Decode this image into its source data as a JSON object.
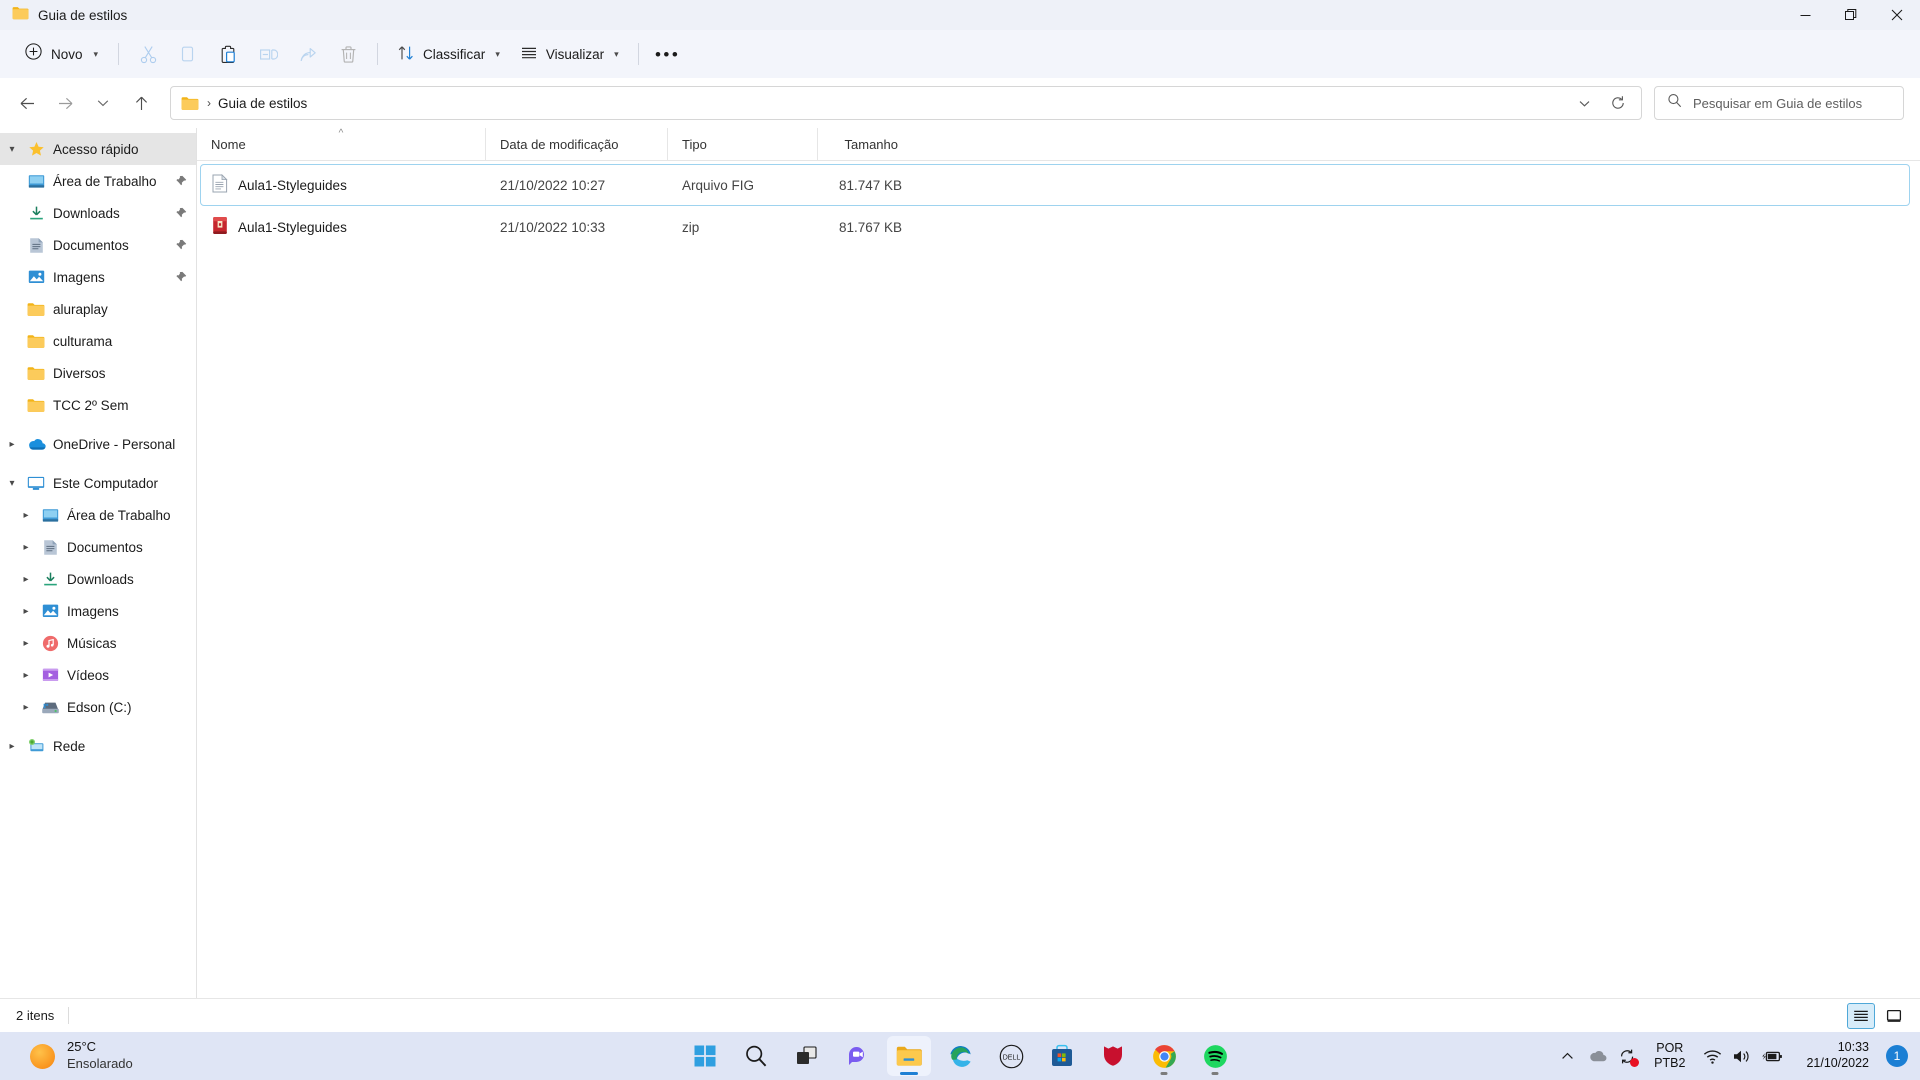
{
  "window": {
    "title": "Guia de estilos",
    "controls": {
      "minimize": "minimize-button",
      "maximize": "restore-button",
      "close": "close-button"
    }
  },
  "toolbar": {
    "new_label": "Novo",
    "sort_label": "Classificar",
    "view_label": "Visualizar",
    "more_label": "See more",
    "icons": [
      "cut-icon",
      "copy-icon",
      "paste-icon",
      "rename-icon",
      "share-icon",
      "delete-icon"
    ]
  },
  "addressbar": {
    "folder_name": "Guia de estilos",
    "separator": "›",
    "back": "back-button",
    "forward": "forward-button",
    "recent": "recent-locations-button",
    "up": "up-button",
    "previous_locations": "previous-locations-button",
    "refresh": "refresh-button"
  },
  "search": {
    "placeholder": "Pesquisar em Guia de estilos",
    "value": ""
  },
  "sidebar": {
    "items": [
      {
        "label": "Acesso rápido",
        "icon": "star-icon",
        "expander": "chevron-down",
        "level": 1,
        "selected": true,
        "pinned": false
      },
      {
        "label": "Área de Trabalho",
        "icon": "desktop-icon",
        "expander": "",
        "level": 2,
        "selected": false,
        "pinned": true
      },
      {
        "label": "Downloads",
        "icon": "downloads-icon",
        "expander": "",
        "level": 2,
        "selected": false,
        "pinned": true
      },
      {
        "label": "Documentos",
        "icon": "documents-icon",
        "expander": "",
        "level": 2,
        "selected": false,
        "pinned": true
      },
      {
        "label": "Imagens",
        "icon": "pictures-icon",
        "expander": "",
        "level": 2,
        "selected": false,
        "pinned": true
      },
      {
        "label": "aluraplay",
        "icon": "folder-icon",
        "expander": "",
        "level": 2,
        "selected": false,
        "pinned": false
      },
      {
        "label": "culturama",
        "icon": "folder-icon",
        "expander": "",
        "level": 2,
        "selected": false,
        "pinned": false
      },
      {
        "label": "Diversos",
        "icon": "folder-icon",
        "expander": "",
        "level": 2,
        "selected": false,
        "pinned": false
      },
      {
        "label": "TCC 2º Sem",
        "icon": "folder-icon",
        "expander": "",
        "level": 2,
        "selected": false,
        "pinned": false
      },
      {
        "label": "OneDrive - Personal",
        "icon": "onedrive-icon",
        "expander": "chevron-right",
        "level": 1,
        "selected": false,
        "pinned": false
      },
      {
        "label": "Este Computador",
        "icon": "this-pc-icon",
        "expander": "chevron-down",
        "level": 1,
        "selected": false,
        "pinned": false
      },
      {
        "label": "Área de Trabalho",
        "icon": "desktop-icon",
        "expander": "chevron-right",
        "level": 2,
        "selected": false,
        "pinned": false
      },
      {
        "label": "Documentos",
        "icon": "documents-icon",
        "expander": "chevron-right",
        "level": 2,
        "selected": false,
        "pinned": false
      },
      {
        "label": "Downloads",
        "icon": "downloads-icon",
        "expander": "chevron-right",
        "level": 2,
        "selected": false,
        "pinned": false
      },
      {
        "label": "Imagens",
        "icon": "pictures-icon",
        "expander": "chevron-right",
        "level": 2,
        "selected": false,
        "pinned": false
      },
      {
        "label": "Músicas",
        "icon": "music-icon",
        "expander": "chevron-right",
        "level": 2,
        "selected": false,
        "pinned": false
      },
      {
        "label": "Vídeos",
        "icon": "videos-icon",
        "expander": "chevron-right",
        "level": 2,
        "selected": false,
        "pinned": false
      },
      {
        "label": "Edson  (C:)",
        "icon": "local-disk-icon",
        "expander": "chevron-right",
        "level": 2,
        "selected": false,
        "pinned": false
      },
      {
        "label": "Rede",
        "icon": "network-icon",
        "expander": "chevron-right",
        "level": 1,
        "selected": false,
        "pinned": false
      }
    ]
  },
  "filelist": {
    "columns": [
      {
        "label": "Nome",
        "sorted": true,
        "sort_direction": "asc"
      },
      {
        "label": "Data de modificação",
        "sorted": false,
        "sort_direction": ""
      },
      {
        "label": "Tipo",
        "sorted": false,
        "sort_direction": ""
      },
      {
        "label": "Tamanho",
        "sorted": false,
        "sort_direction": ""
      }
    ],
    "rows": [
      {
        "name": "Aula1-Styleguides",
        "date": "21/10/2022 10:27",
        "type": "Arquivo FIG",
        "size": "81.747 KB",
        "icon": "generic-file-icon",
        "selected": true
      },
      {
        "name": "Aula1-Styleguides",
        "date": "21/10/2022 10:33",
        "type": "zip",
        "size": "81.767 KB",
        "icon": "winrar-archive-icon",
        "selected": false
      }
    ]
  },
  "statusbar": {
    "item_count": "2 itens",
    "details_view": "details-view-button",
    "large_icons_view": "large-icons-view-button"
  },
  "taskbar": {
    "weather": {
      "temperature": "25°C",
      "condition": "Ensolarado"
    },
    "apps": [
      {
        "name": "start-button",
        "running": false,
        "active": false
      },
      {
        "name": "search-button",
        "running": false,
        "active": false
      },
      {
        "name": "task-view-button",
        "running": false,
        "active": false
      },
      {
        "name": "chat-button",
        "running": false,
        "active": false
      },
      {
        "name": "file-explorer-button",
        "running": true,
        "active": true
      },
      {
        "name": "microsoft-edge-button",
        "running": false,
        "active": false
      },
      {
        "name": "dell-button",
        "running": false,
        "active": false
      },
      {
        "name": "microsoft-store-button",
        "running": false,
        "active": false
      },
      {
        "name": "mcafee-button",
        "running": false,
        "active": false
      },
      {
        "name": "google-chrome-button",
        "running": true,
        "active": false
      },
      {
        "name": "spotify-button",
        "running": true,
        "active": false
      }
    ],
    "tray": {
      "language_primary": "POR",
      "language_secondary": "PTB2",
      "time": "10:33",
      "date": "21/10/2022",
      "notification_count": "1"
    }
  },
  "colors": {
    "accent": "#1b7fd4",
    "titlebar_bg": "#eef1f8",
    "toolbar_bg": "#f3f5fb",
    "taskbar_bg": "#dfe5f5",
    "selection_border": "#9ed3ef",
    "folder_yellow": "#f7c95c"
  }
}
